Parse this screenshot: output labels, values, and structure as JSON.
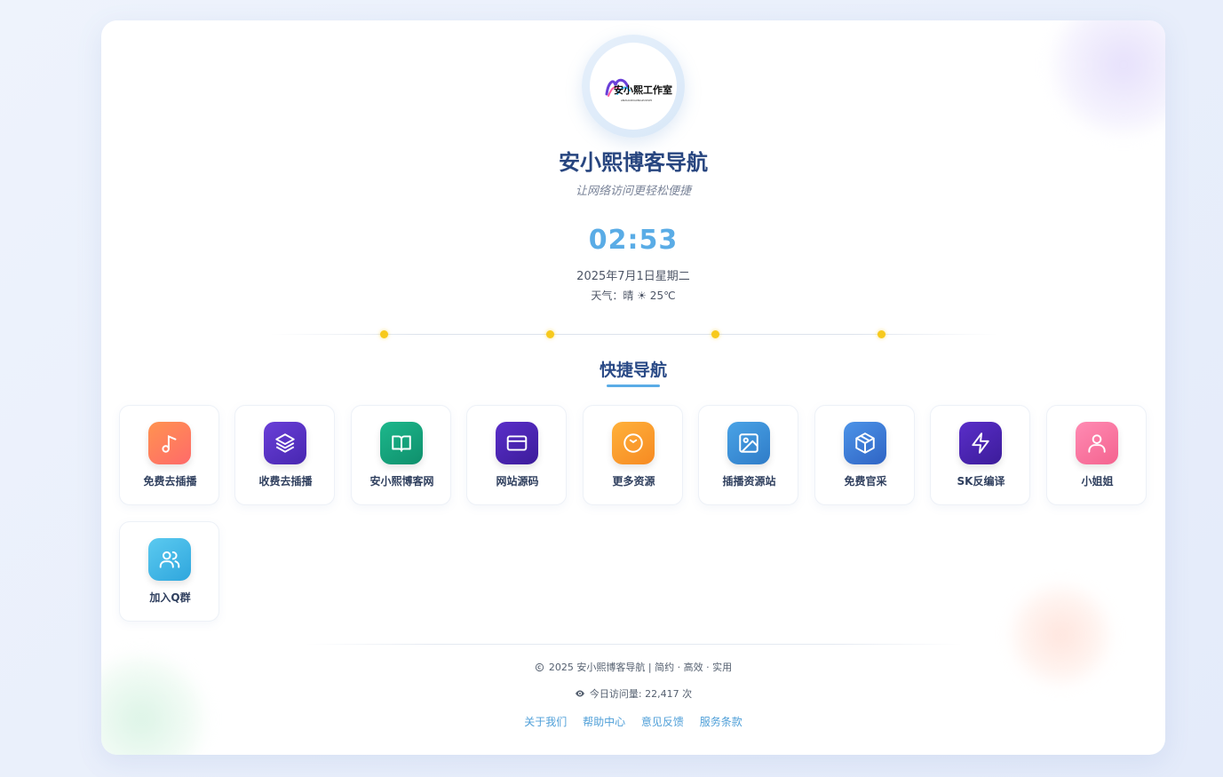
{
  "logo": {
    "brand_text": "安小熙工作室",
    "brand_subtext": "ANXIAOXIGONGZUOSHI"
  },
  "header": {
    "title": "安小熙博客导航",
    "slogan": "让网络访问更轻松便捷"
  },
  "clock": {
    "time": "02:53",
    "date": "2025年7月1日星期二",
    "weather": "天气：晴 ☀ 25℃"
  },
  "section": {
    "title": "快捷导航"
  },
  "nav": [
    {
      "label": "免费去插播",
      "icon": "music-note-icon",
      "color": "#ff7b5c"
    },
    {
      "label": "收费去插播",
      "icon": "layers-icon",
      "color": "#5b35c9"
    },
    {
      "label": "安小熙博客网",
      "icon": "book-icon",
      "color": "#16a37e"
    },
    {
      "label": "网站源码",
      "icon": "credit-card-icon",
      "color": "#4c25b5"
    },
    {
      "label": "更多资源",
      "icon": "clock-icon",
      "color": "#f9a330"
    },
    {
      "label": "插播资源站",
      "icon": "image-icon",
      "color": "#3a8fd6"
    },
    {
      "label": "免费官采",
      "icon": "box-icon",
      "color": "#3f7fdc"
    },
    {
      "label": "SK反编译",
      "icon": "lightning-icon",
      "color": "#4a24b0"
    },
    {
      "label": "小姐姐",
      "icon": "user-icon",
      "color": "#f875a2"
    },
    {
      "label": "加入Q群",
      "icon": "users-icon",
      "color": "#4bb8e6"
    }
  ],
  "footer": {
    "copyright": "2025 安小熙博客导航 | 简约 · 高效 · 实用",
    "visits": "今日访问量: 22,417 次",
    "links": [
      "关于我们",
      "帮助中心",
      "意见反馈",
      "服务条款"
    ]
  }
}
